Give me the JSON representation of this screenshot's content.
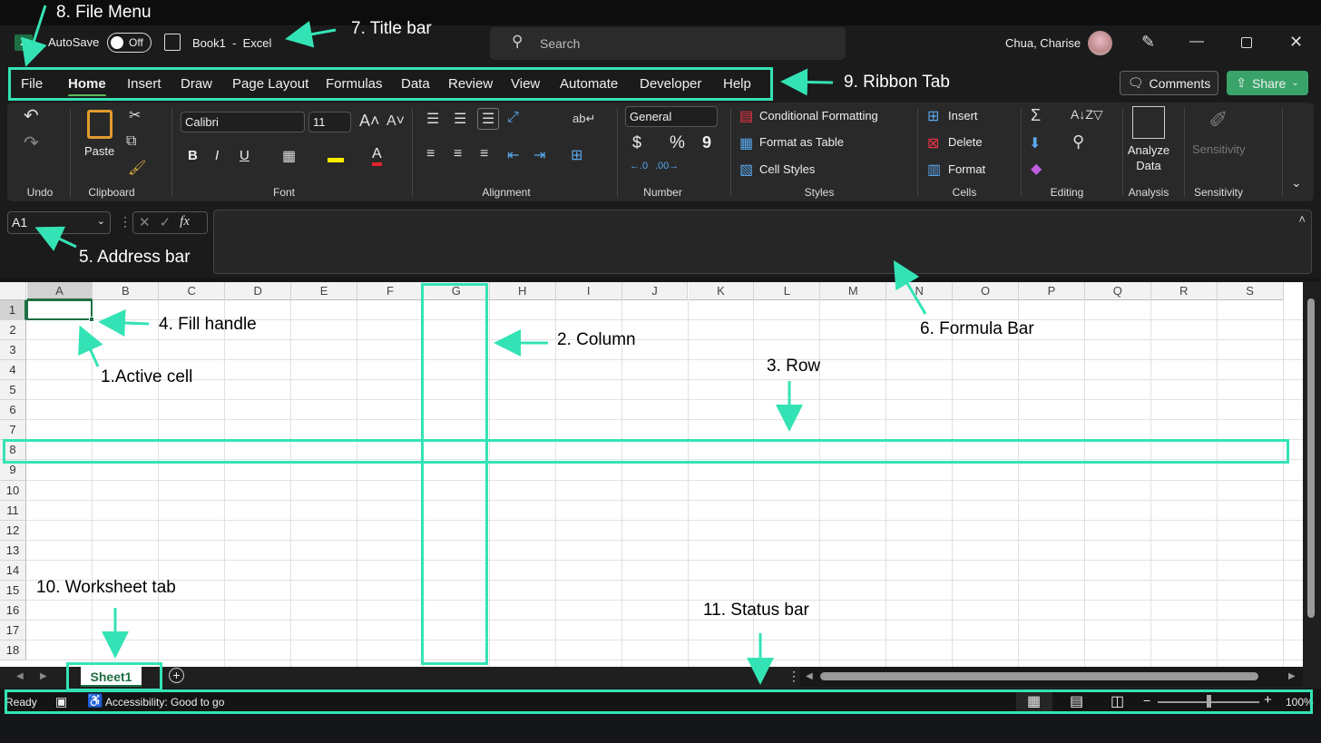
{
  "title_bar": {
    "autosave_label": "AutoSave",
    "autosave_state": "Off",
    "document_title": "Book1  -  Excel",
    "search_placeholder": "Search",
    "user_name": "Chua, Charise"
  },
  "ribbon_tabs": [
    "File",
    "Home",
    "Insert",
    "Draw",
    "Page Layout",
    "Formulas",
    "Data",
    "Review",
    "View",
    "Automate",
    "Developer",
    "Help"
  ],
  "active_tab": "Home",
  "actions": {
    "comments": "Comments",
    "share": "Share"
  },
  "ribbon": {
    "groups": {
      "undo": "Undo",
      "clipboard": "Clipboard",
      "font": "Font",
      "alignment": "Alignment",
      "number": "Number",
      "styles": "Styles",
      "cells": "Cells",
      "editing": "Editing",
      "analysis": "Analysis",
      "sensitivity": "Sensitivity"
    },
    "paste": "Paste",
    "font_name": "Calibri",
    "font_size": "11",
    "number_format": "General",
    "conditional_formatting": "Conditional Formatting",
    "format_as_table": "Format as Table",
    "cell_styles": "Cell Styles",
    "insert": "Insert",
    "delete": "Delete",
    "format": "Format",
    "analyze_data": "Analyze Data",
    "sensitivity_btn": "Sensitivity",
    "bold": "B",
    "italic": "I",
    "underline": "U",
    "font_color": "A",
    "currency": "$",
    "percent": "%",
    "comma": "9"
  },
  "formula_bar": {
    "name_box": "A1",
    "fx": "fx",
    "formula": ""
  },
  "sheet": {
    "columns": [
      "A",
      "B",
      "C",
      "D",
      "E",
      "F",
      "G",
      "H",
      "I",
      "J",
      "K",
      "L",
      "M",
      "N",
      "O",
      "P",
      "Q",
      "R",
      "S"
    ],
    "rows": [
      "1",
      "2",
      "3",
      "4",
      "5",
      "6",
      "7",
      "8",
      "9",
      "10",
      "11",
      "12",
      "13",
      "14",
      "15",
      "16",
      "17",
      "18"
    ],
    "active_cell": "A1"
  },
  "sheet_tabs": [
    "Sheet1"
  ],
  "status_bar": {
    "ready": "Ready",
    "accessibility": "Accessibility: Good to go",
    "zoom": "100%",
    "zoom_fraction": 0.5
  },
  "annotations": {
    "file_menu": "8. File Menu",
    "title_bar": "7. Title bar",
    "ribbon_tab": "9. Ribbon Tab",
    "address_bar": "5. Address bar",
    "formula_bar": "6. Formula Bar",
    "fill_handle": "4. Fill handle",
    "column": "2. Column",
    "row": "3. Row",
    "active_cell": "1.Active cell",
    "worksheet_tab": "10. Worksheet tab",
    "status_bar": "11. Status bar"
  },
  "colors": {
    "annotation": "#34e3b5",
    "share": "#3aa36a",
    "excel": "#1d6f42"
  }
}
